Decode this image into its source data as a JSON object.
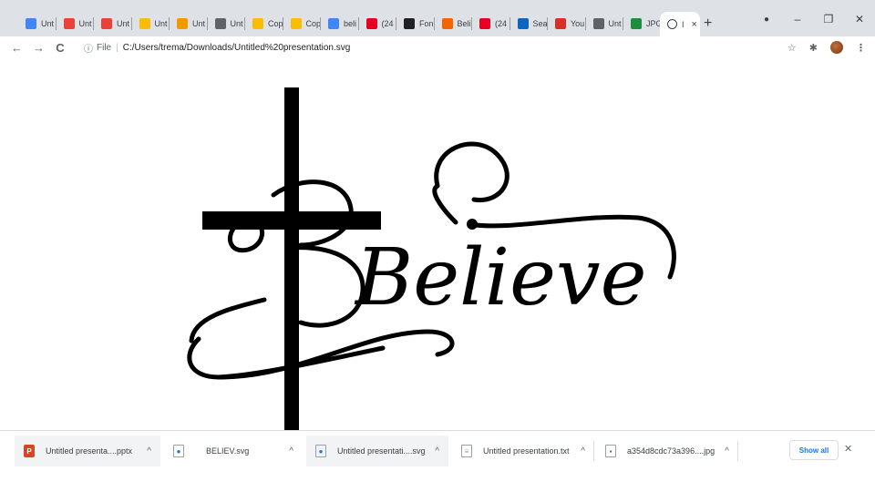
{
  "tabs": [
    {
      "label": "Unt",
      "icon": "docs-icon",
      "color": "#4285f4"
    },
    {
      "label": "Unt",
      "icon": "red-square-icon",
      "color": "#ea4335"
    },
    {
      "label": "Unt",
      "icon": "red-square-icon",
      "color": "#ea4335"
    },
    {
      "label": "Unt",
      "icon": "slides-icon",
      "color": "#fbbc04"
    },
    {
      "label": "Unt",
      "icon": "brush-icon",
      "color": "#f29900"
    },
    {
      "label": "Unt",
      "icon": "globe-icon",
      "color": "#5f6368"
    },
    {
      "label": "Cop",
      "icon": "slides-icon",
      "color": "#fbbc04"
    },
    {
      "label": "Cop",
      "icon": "slides-icon",
      "color": "#fbbc04"
    },
    {
      "label": "beli",
      "icon": "google-icon",
      "color": "#4285f4"
    },
    {
      "label": "(24",
      "icon": "pinterest-icon",
      "color": "#e60023"
    },
    {
      "label": "Fon",
      "icon": "circle-icon",
      "color": "#202124"
    },
    {
      "label": "Beli",
      "icon": "etsy-icon",
      "color": "#f56400"
    },
    {
      "label": "(24",
      "icon": "pinterest-icon",
      "color": "#e60023"
    },
    {
      "label": "Sea",
      "icon": "linkedin-icon",
      "color": "#0a66c2"
    },
    {
      "label": "You",
      "icon": "gmail-icon",
      "color": "#d93025"
    },
    {
      "label": "Unt",
      "icon": "globe-icon",
      "color": "#5f6368"
    },
    {
      "label": "JPG",
      "icon": "converter-icon",
      "color": "#1e8e3e"
    }
  ],
  "active_tab": {
    "label": "I",
    "close": "×"
  },
  "new_tab": "+",
  "window": {
    "minimize": "–",
    "restore": "❐",
    "close": "✕"
  },
  "toolbar": {
    "back": "←",
    "forward": "→",
    "reload": "C",
    "info": "ⓘ",
    "scheme": "File",
    "divider": "|",
    "url": "C:/Users/trema/Downloads/Untitled%20presentation.svg",
    "star": "☆",
    "extensions": "✱",
    "menu": "⋮"
  },
  "artwork": {
    "word": "Believe"
  },
  "downloads": [
    {
      "name": "Untitled presenta....pptx",
      "icon": "powerpoint-icon"
    },
    {
      "name": "BELIEV.svg",
      "icon": "chrome-file-icon"
    },
    {
      "name": "Untitled presentati....svg",
      "icon": "chrome-file-icon"
    },
    {
      "name": "Untitled presentation.txt",
      "icon": "text-file-icon"
    },
    {
      "name": "a354d8cdc73a396....jpg",
      "icon": "image-file-icon"
    }
  ],
  "downloads_chevron": "^",
  "show_all": "Show all",
  "shelf_close": "✕"
}
